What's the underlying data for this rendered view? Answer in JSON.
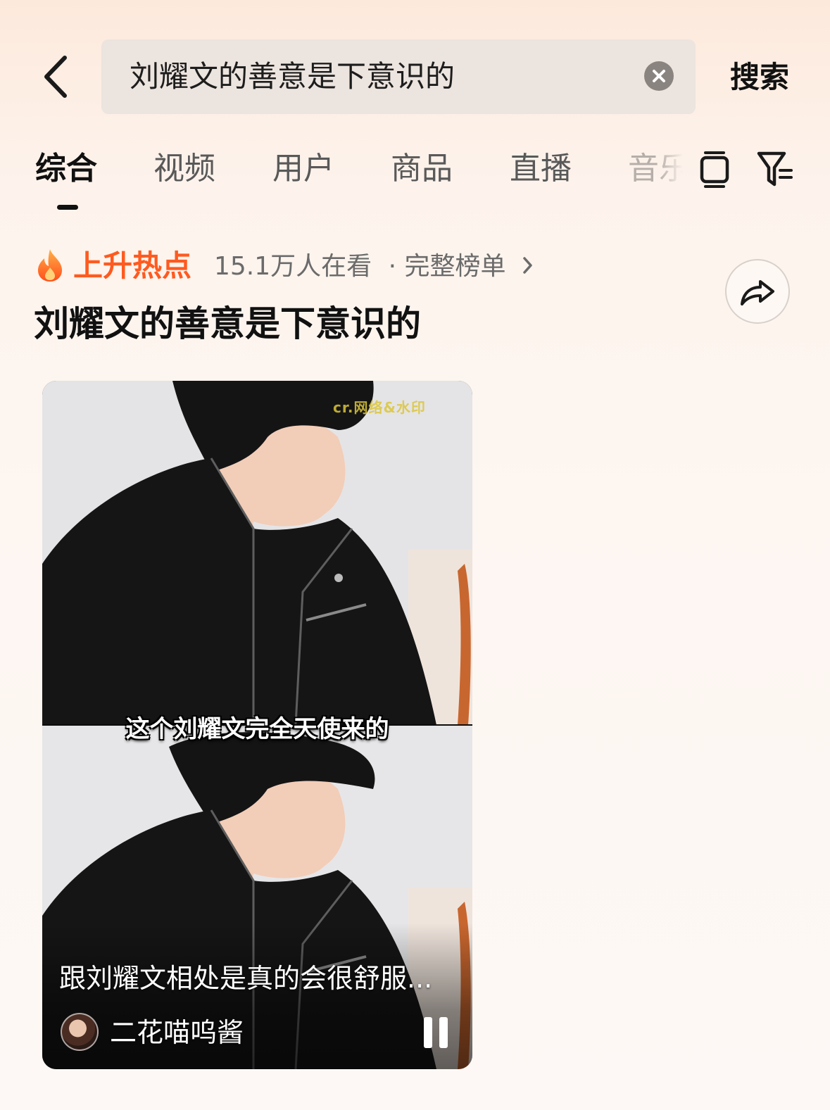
{
  "search": {
    "query": "刘耀文的善意是下意识的",
    "submit_label": "搜索"
  },
  "tabs": [
    {
      "label": "综合",
      "active": true
    },
    {
      "label": "视频"
    },
    {
      "label": "用户"
    },
    {
      "label": "商品"
    },
    {
      "label": "直播"
    },
    {
      "label": "音乐"
    }
  ],
  "hot": {
    "label": "上升热点",
    "viewers": "15.1万人在看",
    "full_list": "· 完整榜单",
    "title": "刘耀文的善意是下意识的"
  },
  "video": {
    "watermark": "cr.网络&水印",
    "subtitle": "这个刘耀文完全天使来的",
    "title": "跟刘耀文相处是真的会很舒服...",
    "author": "二花喵呜酱",
    "playing": true
  },
  "colors": {
    "accent": "#ff5a1f",
    "watermark": "#dcc63a"
  },
  "icons": [
    "back-icon",
    "clear-icon",
    "view-mode-icon",
    "filter-icon",
    "fire-icon",
    "share-icon",
    "pause-icon"
  ]
}
